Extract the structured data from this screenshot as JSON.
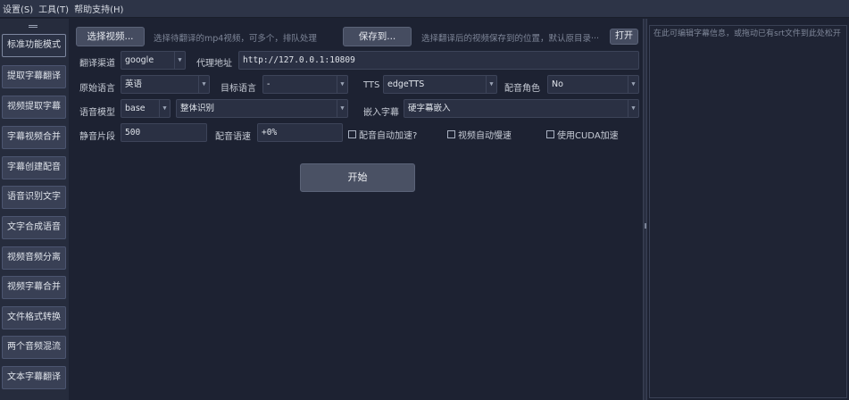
{
  "menu": [
    "设置(S)",
    "工具(T)",
    "帮助支持(H)"
  ],
  "sidebar": {
    "items": [
      {
        "label": "标准功能模式",
        "active": true
      },
      {
        "label": "提取字幕翻译"
      },
      {
        "label": "视频提取字幕"
      },
      {
        "label": "字幕视频合并"
      },
      {
        "label": "字幕创建配音"
      },
      {
        "label": "语音识别文字"
      },
      {
        "label": "文字合成语音"
      },
      {
        "label": "视频音频分离"
      },
      {
        "label": "视频字幕合并"
      },
      {
        "label": "文件格式转换"
      },
      {
        "label": "两个音频混流"
      },
      {
        "label": "文本字幕翻译"
      }
    ]
  },
  "toolbar": {
    "select_video": "选择视频...",
    "select_hint": "选择待翻译的mp4视频，可多个，排队处理",
    "save_to": "保存到...",
    "save_hint": "选择翻译后的视频保存到的位置，默认原目录···",
    "open": "打开"
  },
  "form": {
    "translate_channel_label": "翻译渠道",
    "translate_channel": "google",
    "proxy_label": "代理地址",
    "proxy": "http://127.0.0.1:10809",
    "source_lang_label": "原始语言",
    "source_lang": "英语",
    "target_lang_label": "目标语言",
    "target_lang": "-",
    "tts_label": "TTS",
    "tts": "edgeTTS",
    "voice_role_label": "配音角色",
    "voice_role": "No",
    "model_label": "语音模型",
    "model": "base",
    "recognition": "整体识别",
    "embed_sub_label": "嵌入字幕",
    "embed_sub": "硬字幕嵌入",
    "silence_label": "静音片段",
    "silence": "500",
    "voice_rate_label": "配音语速",
    "voice_rate": "+0%",
    "auto_accel": "配音自动加速?",
    "auto_slow": "视频自动慢速",
    "cuda": "使用CUDA加速"
  },
  "start_button": "开始",
  "subtitle_placeholder": "在此可编辑字幕信息，或拖动已有srt文件到此处松开"
}
